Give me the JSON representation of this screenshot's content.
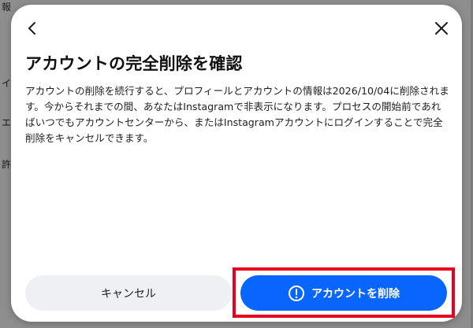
{
  "background": {
    "fragments": [
      "報",
      "イ",
      "エ",
      "許"
    ]
  },
  "dialog": {
    "title": "アカウントの完全削除を確認",
    "body": "アカウントの削除を続行すると、プロフィールとアカウントの情報は2026/10/04に削除されます。今からそれまでの間、あなたはInstagramで非表示になります。プロセスの開始前であればいつでもアカウントセンターから、またはInstagramアカウントにログインすることで完全削除をキャンセルできます。",
    "cancel_label": "キャンセル",
    "delete_label": "アカウントを削除",
    "icons": {
      "back": "chevron-left-icon",
      "close": "close-icon",
      "delete": "alert-circle-icon"
    }
  },
  "colors": {
    "primary": "#0866ff",
    "cancel_bg": "#eef0f3",
    "highlight": "#e8001f"
  }
}
